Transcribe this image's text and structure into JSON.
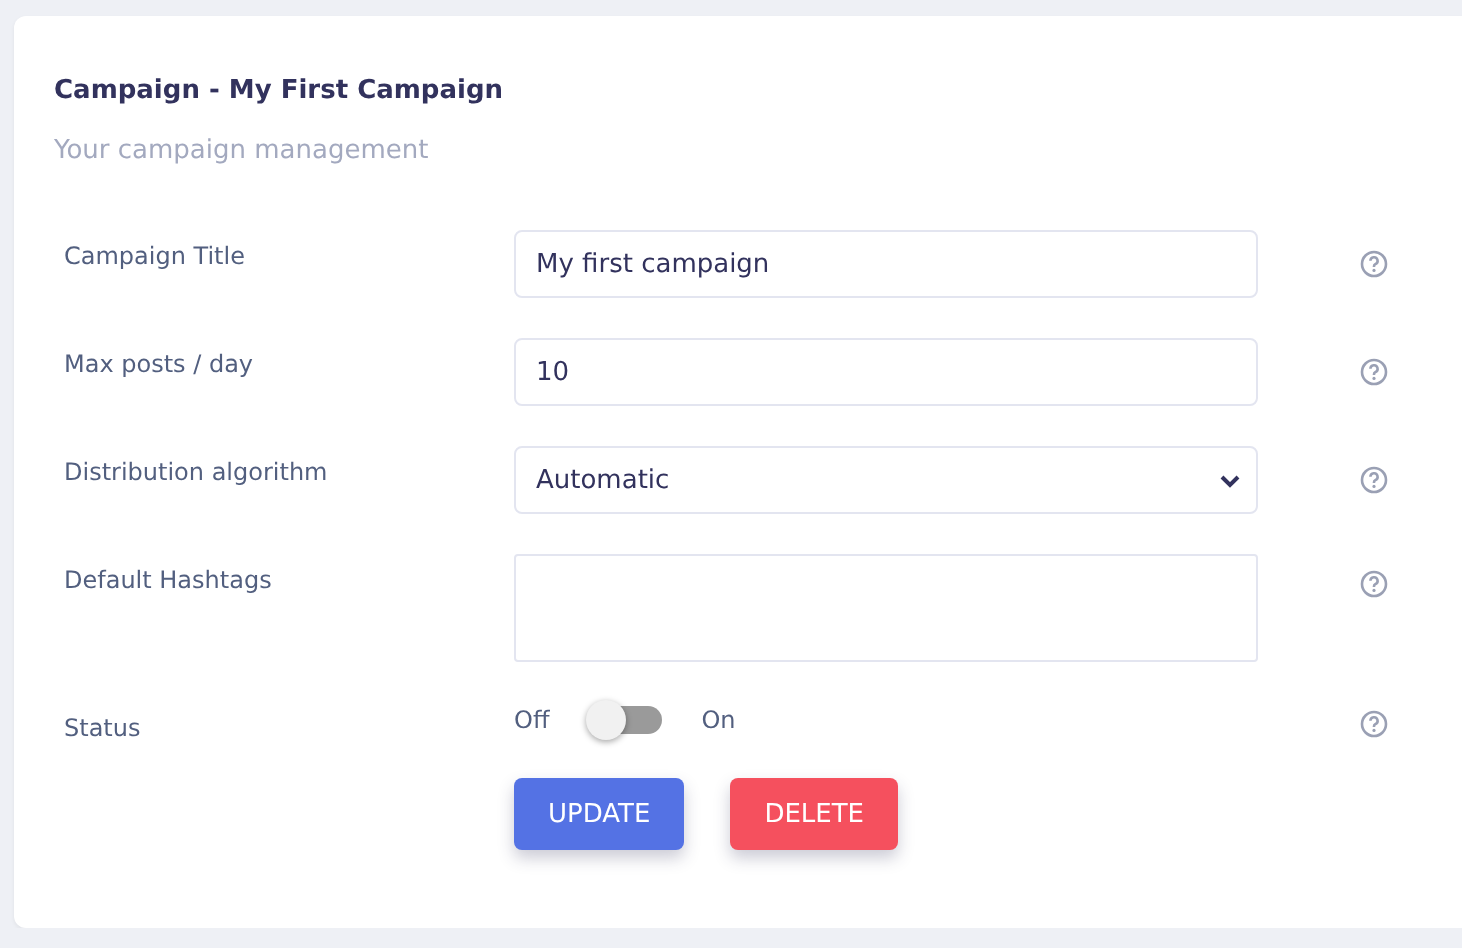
{
  "card": {
    "title": "Campaign - My First Campaign",
    "subtitle": "Your campaign management"
  },
  "fields": [
    {
      "kind": "text",
      "label": "Campaign Title",
      "value": "My first campaign"
    },
    {
      "kind": "text",
      "label": "Max posts / day",
      "value": "10"
    },
    {
      "kind": "select",
      "label": "Distribution algorithm",
      "value": "Automatic"
    },
    {
      "kind": "textarea",
      "label": "Default Hashtags"
    },
    {
      "kind": "toggle",
      "label": "Status",
      "off_label": "Off",
      "on_label": "On",
      "on": false
    }
  ],
  "buttons": [
    {
      "kind": "primary",
      "label": "UPDATE"
    },
    {
      "kind": "danger",
      "label": "DELETE"
    }
  ]
}
